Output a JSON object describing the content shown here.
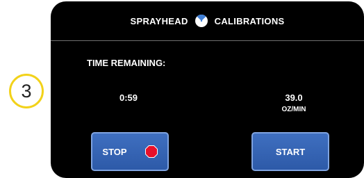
{
  "step_number": "3",
  "header": {
    "title_left": "SPRAYHEAD",
    "title_right": "CALIBRATIONS",
    "icon": "gauge-icon"
  },
  "calibration": {
    "time_label": "TIME REMAINING:",
    "time_value": "0:59",
    "rate_value": "39.0",
    "rate_unit": "OZ/MIN"
  },
  "buttons": {
    "stop_label": "STOP",
    "start_label": "START",
    "stop_icon": "stop-sign-icon"
  },
  "colors": {
    "badge_ring": "#f2d21a",
    "button_blue": "#2d5aa8",
    "stop_red": "#e8102a",
    "screen_bg": "#000000"
  }
}
